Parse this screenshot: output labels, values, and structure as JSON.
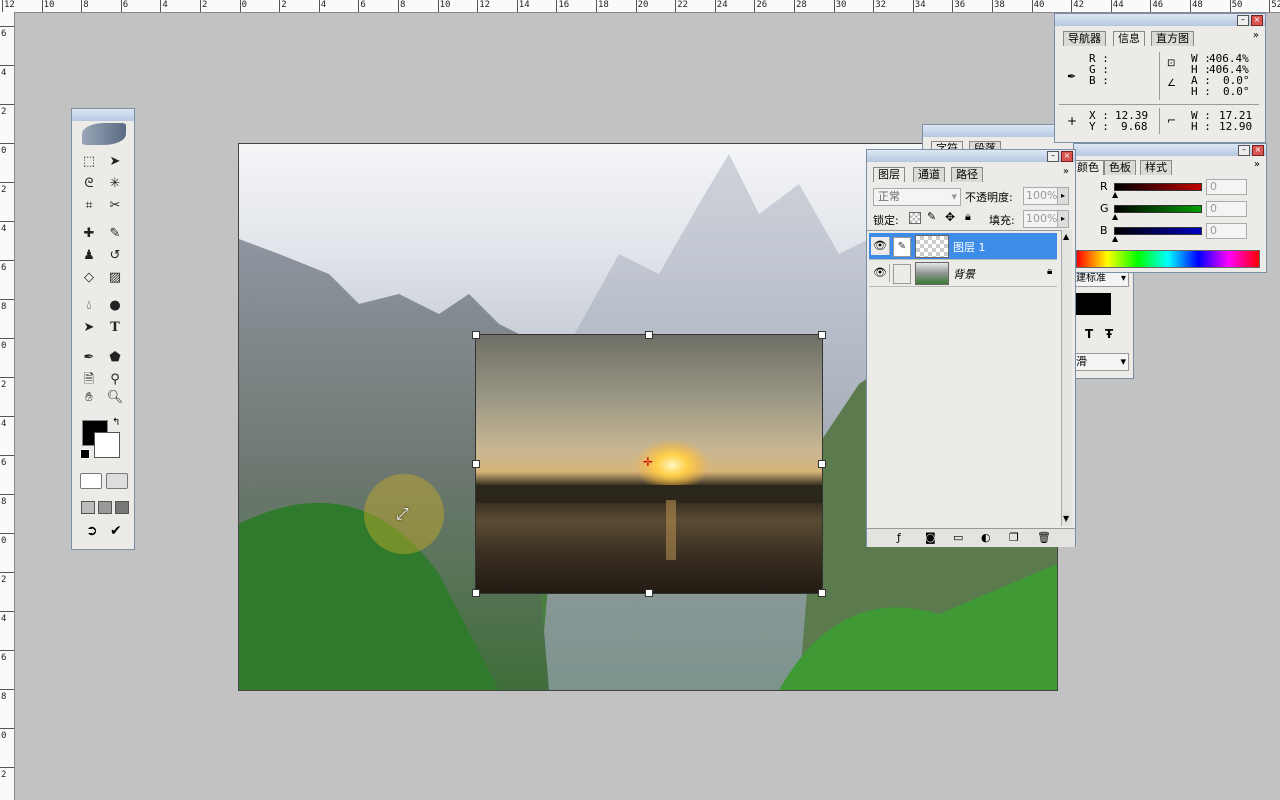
{
  "rulers": {
    "top_labels": [
      "12",
      "10",
      "8",
      "6",
      "4",
      "2",
      "0",
      "2",
      "4",
      "6",
      "8",
      "10",
      "12",
      "14",
      "16",
      "18",
      "20",
      "22",
      "24",
      "26",
      "28",
      "30",
      "32",
      "34",
      "36",
      "38",
      "40",
      "42",
      "44",
      "46",
      "48",
      "50",
      "52"
    ],
    "left_labels": [
      "6",
      "4",
      "2",
      "0",
      "2",
      "4",
      "6",
      "8",
      "0",
      "2",
      "4",
      "6",
      "8",
      "0",
      "2",
      "4",
      "6",
      "8",
      "0",
      "2"
    ]
  },
  "document": {
    "layer_name_active": "图层 1"
  },
  "toolbox": {
    "tools": [
      "marquee-icon",
      "move-icon",
      "lasso-icon",
      "magic-wand-icon",
      "crop-icon",
      "slice-icon",
      "healing-icon",
      "brush-icon",
      "stamp-icon",
      "history-brush-icon",
      "eraser-icon",
      "gradient-icon",
      "blur-icon",
      "dodge-icon",
      "path-select-icon",
      "type-icon",
      "pen-icon",
      "shape-icon",
      "notes-icon",
      "eyedropper-icon",
      "hand-icon",
      "zoom-icon"
    ],
    "type_glyph": "T"
  },
  "info_panel": {
    "tabs": [
      "导航器",
      "信息",
      "直方图"
    ],
    "active_tab": "信息",
    "rgb_labels": [
      "R :",
      "G :",
      "B :"
    ],
    "w_label": "W :",
    "w_value": "406.4%",
    "h_label": "H :",
    "h_value": "406.4%",
    "a_label": "A :",
    "a_value": "0.0°",
    "h2_label": "H :",
    "h2_value": "0.0°",
    "x_label": "X :",
    "x_value": "12.39",
    "y_label": "Y :",
    "y_value": "9.68",
    "w2_label": "W :",
    "w2_value": "17.21",
    "h3_label": "H :",
    "h3_value": "12.90"
  },
  "color_panel": {
    "tabs": [
      "颜色",
      "色板",
      "样式"
    ],
    "channels": [
      {
        "label": "R",
        "value": "0",
        "color": "#c00000"
      },
      {
        "label": "G",
        "value": "0",
        "color": "#00a000"
      },
      {
        "label": "B",
        "value": "0",
        "color": "#0000c0"
      }
    ]
  },
  "behind_panel": {
    "tabs": [
      "字符",
      "段落"
    ],
    "dropdown_label": "建标准",
    "type_btn_1": "T",
    "type_btn_2": "Ŧ",
    "antialias_label": "滑"
  },
  "layers_panel": {
    "tabs": [
      "图层",
      "通道",
      "路径"
    ],
    "blend_mode": "正常",
    "opacity_label": "不透明度:",
    "opacity_value": "100%",
    "lock_label": "锁定:",
    "fill_label": "填充:",
    "fill_value": "100%",
    "layers": [
      {
        "name": "图层 1",
        "selected": true
      },
      {
        "name": "背景",
        "selected": false
      }
    ],
    "bottom_icons": [
      "layer-style-icon",
      "mask-icon",
      "folder-icon",
      "adjustment-icon",
      "new-layer-icon",
      "trash-icon"
    ]
  },
  "colors": {
    "panel_bg": "#ecebe7",
    "selection": "#3d8ce8",
    "canvas_bg": "#c2c2c2"
  }
}
